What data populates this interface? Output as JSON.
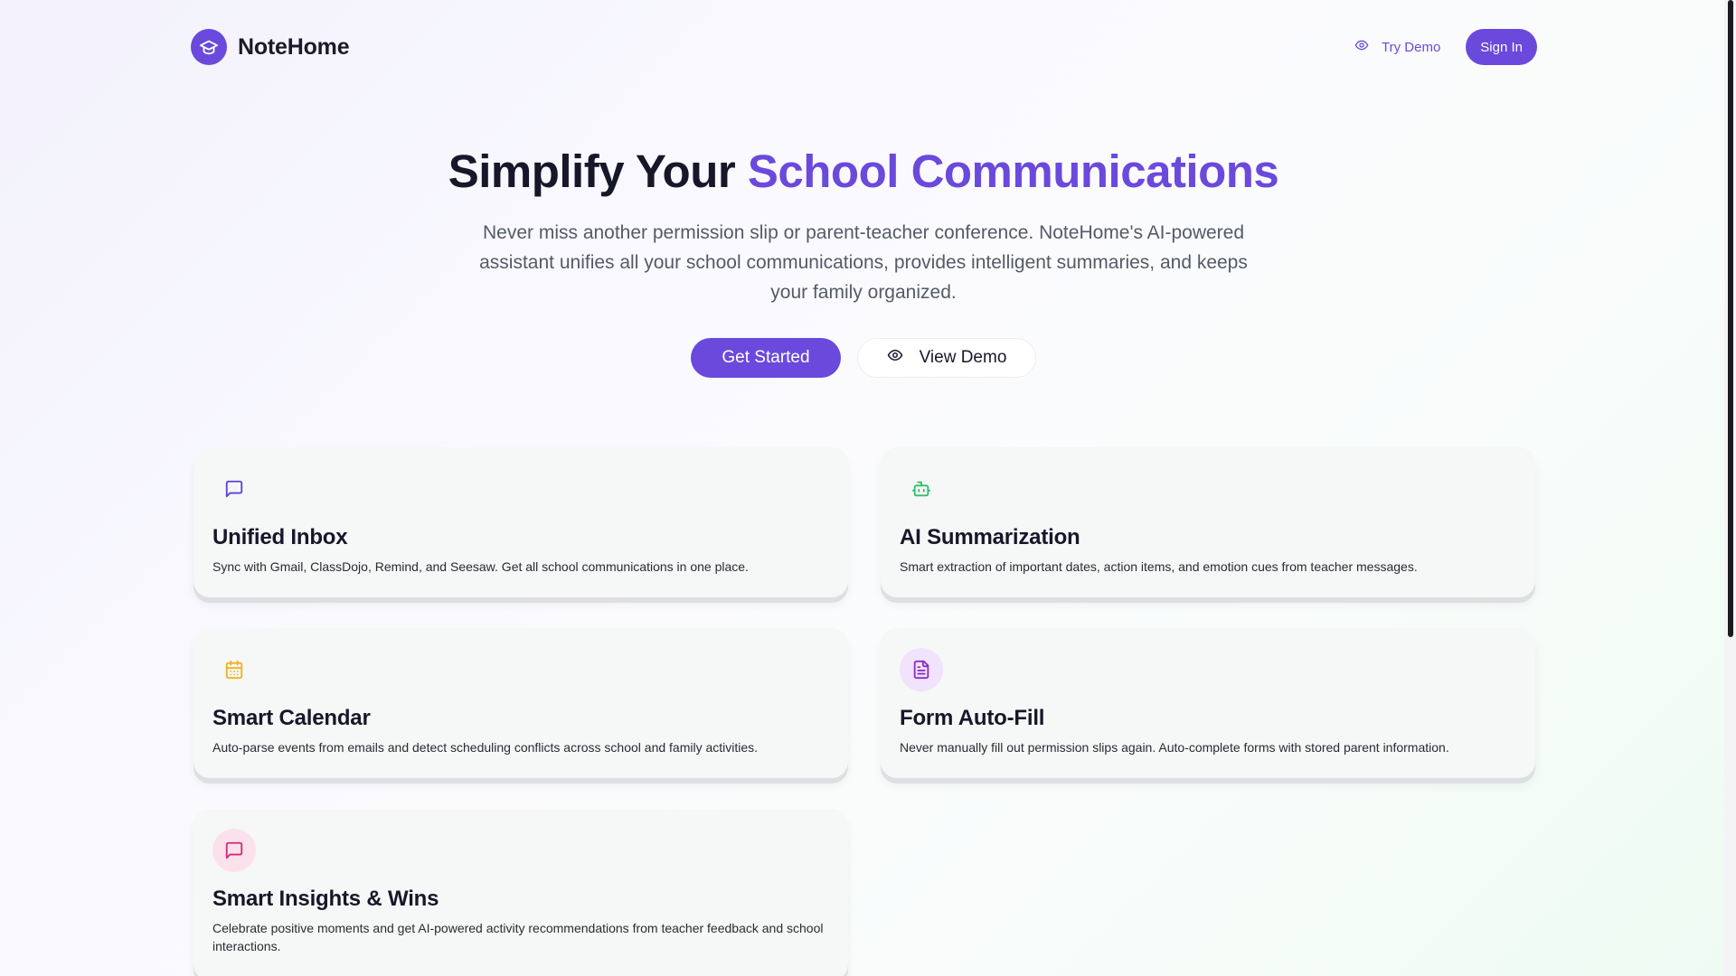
{
  "brand": {
    "name": "NoteHome",
    "logo_icon": "graduation-cap-icon",
    "accent_color": "#6a49dc"
  },
  "nav": {
    "try_demo": "Try Demo",
    "sign_in": "Sign In"
  },
  "hero": {
    "title_plain": "Simplify Your ",
    "title_accent": "School Communications",
    "subtitle": "Never miss another permission slip or parent-teacher conference. NoteHome's AI-powered assistant unifies all your school communications, provides intelligent summaries, and keeps your family organized.",
    "primary_cta": "Get Started",
    "secondary_cta": "View Demo"
  },
  "features": [
    {
      "icon": "message-square-icon",
      "icon_color": "#5b43d6",
      "icon_bg": "transparent",
      "title": "Unified Inbox",
      "description": "Sync with Gmail, ClassDojo, Remind, and Seesaw. Get all school communications in one place."
    },
    {
      "icon": "bot-icon",
      "icon_color": "#2fbf6f",
      "icon_bg": "transparent",
      "title": "AI Summarization",
      "description": "Smart extraction of important dates, action items, and emotion cues from teacher messages."
    },
    {
      "icon": "calendar-icon",
      "icon_color": "#f0b21a",
      "icon_bg": "transparent",
      "title": "Smart Calendar",
      "description": "Auto-parse events from emails and detect scheduling conflicts across school and family activities."
    },
    {
      "icon": "file-text-icon",
      "icon_color": "#8a2fc4",
      "icon_bg": "#f1e3fb",
      "title": "Form Auto-Fill",
      "description": "Never manually fill out permission slips again. Auto-complete forms with stored parent information."
    },
    {
      "icon": "message-square-icon",
      "icon_color": "#d12a77",
      "icon_bg": "#fbe1ec",
      "title": "Smart Insights & Wins",
      "description": "Celebrate positive moments and get AI-powered activity recommendations from teacher feedback and school interactions."
    }
  ]
}
